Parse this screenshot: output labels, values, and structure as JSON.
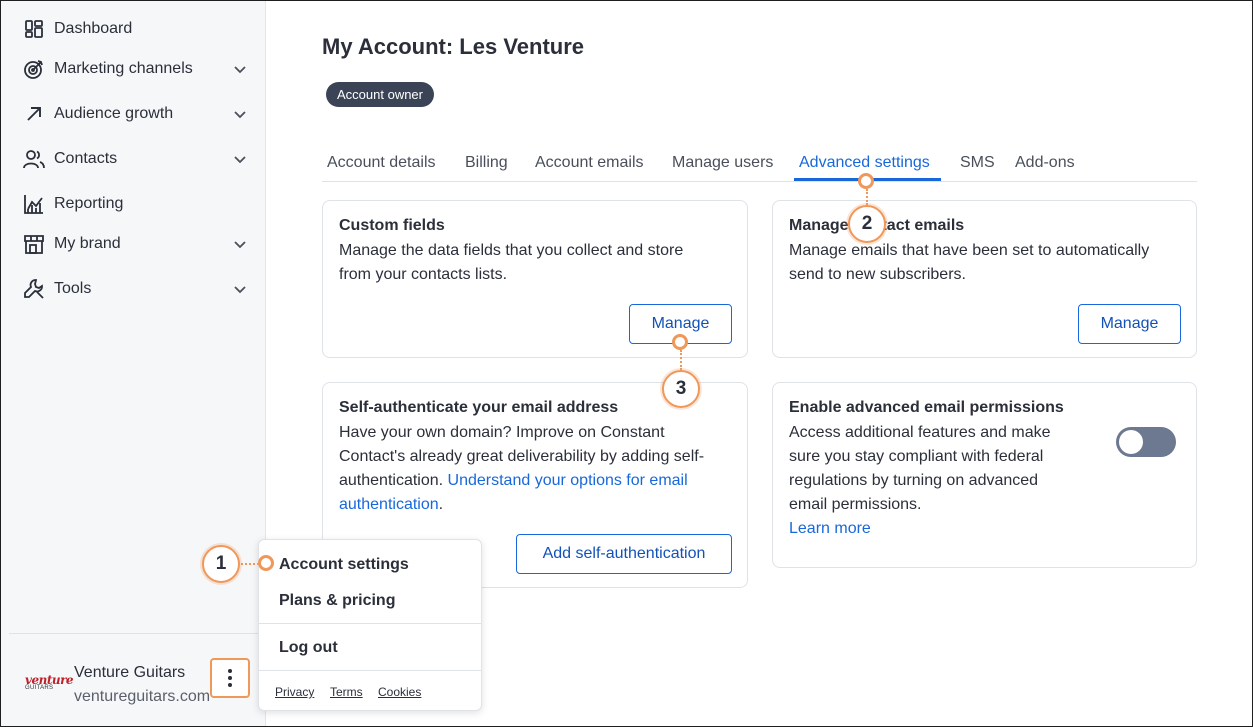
{
  "sidebar": {
    "items": [
      {
        "label": "Dashboard",
        "icon": "dashboard-icon"
      },
      {
        "label": "Marketing channels",
        "icon": "target-icon"
      },
      {
        "label": "Audience growth",
        "icon": "arrow-up-right-icon"
      },
      {
        "label": "Contacts",
        "icon": "contacts-icon"
      },
      {
        "label": "Reporting",
        "icon": "chart-icon"
      },
      {
        "label": "My brand",
        "icon": "storefront-icon"
      },
      {
        "label": "Tools",
        "icon": "wrench-icon"
      }
    ],
    "account": {
      "logo_text": "venture",
      "logo_sub": "GUITARS",
      "name": "Venture Guitars",
      "domain": "ventureguitars.com"
    }
  },
  "header": {
    "title": "My Account: Les Venture",
    "badge": "Account owner"
  },
  "tabs": [
    {
      "label": "Account details"
    },
    {
      "label": "Billing"
    },
    {
      "label": "Account emails"
    },
    {
      "label": "Manage users"
    },
    {
      "label": "Advanced settings",
      "active": true
    },
    {
      "label": "SMS"
    },
    {
      "label": "Add-ons"
    }
  ],
  "cards": {
    "custom_fields": {
      "title": "Custom fields",
      "desc1": "Manage the data fields that you collect and store",
      "desc2": "from your contacts lists.",
      "button": "Manage"
    },
    "contact_emails": {
      "title": "Manage contact emails",
      "desc1": "Manage emails that have been set to automatically",
      "desc2": "send to new subscribers.",
      "button": "Manage"
    },
    "self_auth": {
      "title": "Self-authenticate your email address",
      "desc1": "Have your own domain? Improve on Constant",
      "desc2": "Contact's already great deliverability by adding self-",
      "desc3_prefix": "authentication. ",
      "link1": "Understand your options for email",
      "link2": "authentication",
      "desc4_suffix": ".",
      "button": "Add self-authentication"
    },
    "advanced_permissions": {
      "title": "Enable advanced email permissions",
      "desc1": "Access additional features and make",
      "desc2": "sure you stay compliant with federal",
      "desc3": "regulations by turning on advanced",
      "desc4": "email permissions.",
      "link": "Learn more",
      "toggle_on": false
    }
  },
  "menu": {
    "items": [
      "Account settings",
      "Plans & pricing",
      "Log out"
    ],
    "footer": [
      "Privacy",
      "Terms",
      "Cookies"
    ]
  },
  "callouts": [
    "1",
    "2",
    "3"
  ],
  "colors": {
    "accent": "#1868db",
    "callout": "#f0975a",
    "badge": "#3b4457",
    "toggle_off": "#6d7891"
  }
}
